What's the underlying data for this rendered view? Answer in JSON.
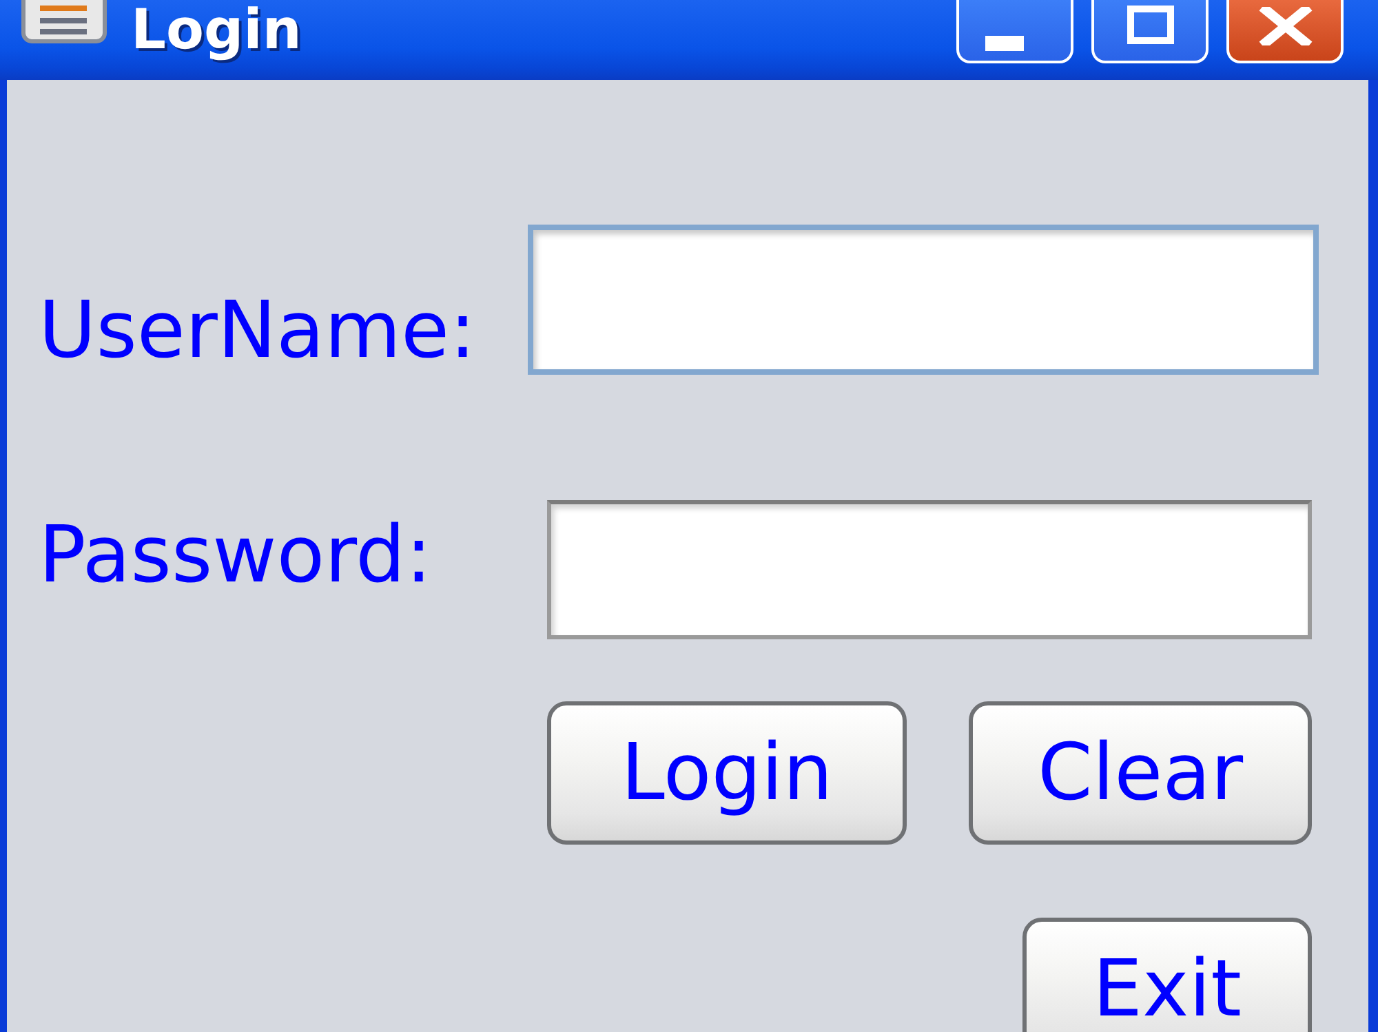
{
  "window": {
    "title": "Login"
  },
  "fields": [
    {
      "label": "UserName:",
      "focused": true
    },
    {
      "label": "Password:",
      "focused": false
    }
  ],
  "buttons": [
    {
      "label": "Login"
    },
    {
      "label": "Clear"
    },
    {
      "label": "Exit"
    }
  ]
}
